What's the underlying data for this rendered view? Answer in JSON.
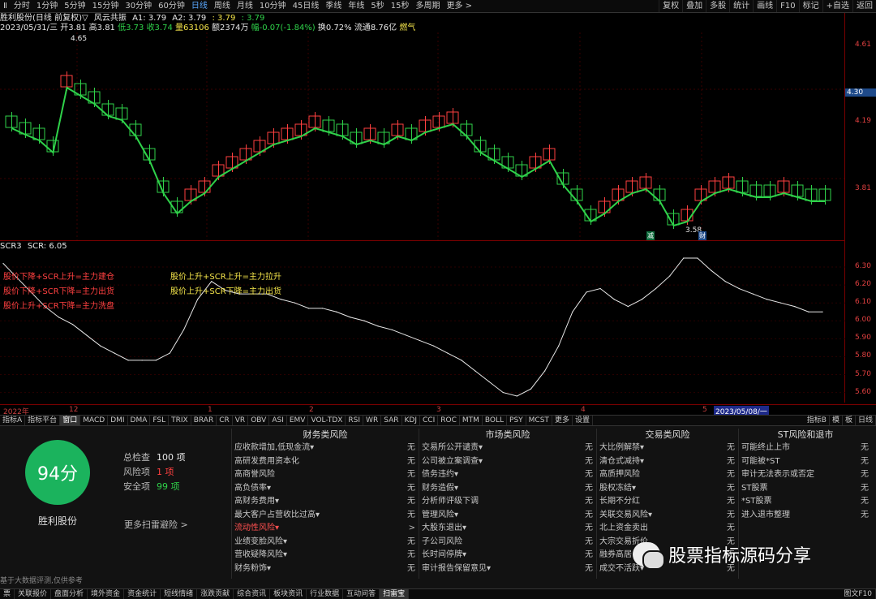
{
  "toolbar": {
    "left": [
      "分时",
      "1分钟",
      "5分钟",
      "15分钟",
      "30分钟",
      "60分钟",
      "日线",
      "周线",
      "月线",
      "10分钟",
      "45日线",
      "季线",
      "年线",
      "5秒",
      "15秒",
      "多周期",
      "更多 >"
    ],
    "active_index": 6,
    "right": [
      "复权",
      "叠加",
      "多股",
      "统计",
      "画线",
      "F10",
      "标记",
      "+自选",
      "返回"
    ]
  },
  "info": {
    "title": "胜利股份(日线 前复权)",
    "title_arrow": "▽",
    "indicator": "风云共振",
    "a1": "A1: 3.79",
    "a2": "A2: 3.79",
    "a2b": ": 3.79",
    "a2c": ": 3.79",
    "date": "2023/05/31/三",
    "open": "开3.81",
    "high": "高3.81",
    "low": "低3.73",
    "close": "收3.74",
    "volume": "量63106",
    "amount": "额2374万",
    "change": "幅-0.07(-1.84%)",
    "turnover": "换0.72%",
    "float": "流通8.76亿",
    "sector": "燃气"
  },
  "price_axis": {
    "labels": [
      "4.61",
      "4.30",
      "4.19",
      "3.81",
      "3.58"
    ],
    "current": "4.30",
    "high_mark": "4.65",
    "low_mark": "3.58"
  },
  "markers": [
    "减",
    "财"
  ],
  "scr": {
    "title": "SCR3",
    "value": "SCR: 6.05",
    "labels": [
      "6.30",
      "6.20",
      "6.10",
      "6.00",
      "5.90",
      "5.80",
      "5.70",
      "5.60"
    ]
  },
  "annotations": {
    "red": [
      "股价下降+SCR上升=主力建仓",
      "股价下降+SCR下降=主力出货",
      "股价上升+SCR下降=主力洗盘"
    ],
    "yellow": [
      "股价上升+SCR上升=主力拉升",
      "股价上升+SCR下降=主力出货"
    ]
  },
  "chart_data": {
    "type": "line",
    "series": [
      {
        "name": "SCR",
        "y": [
          6.32,
          6.24,
          6.16,
          6.08,
          6.02,
          5.98,
          5.92,
          5.86,
          5.82,
          5.78,
          5.78,
          5.78,
          5.82,
          5.95,
          6.12,
          6.22,
          6.17,
          6.15,
          6.15,
          6.15,
          6.12,
          6.1,
          6.07,
          6.07,
          6.05,
          6.02,
          6.0,
          5.97,
          5.95,
          5.92,
          5.89,
          5.86,
          5.82,
          5.78,
          5.72,
          5.66,
          5.6,
          5.58,
          5.62,
          5.72,
          5.86,
          6.05,
          6.16,
          6.18,
          6.12,
          6.08,
          6.12,
          6.18,
          6.25,
          6.35,
          6.35,
          6.28,
          6.22,
          6.18,
          6.15,
          6.12,
          6.1,
          6.08,
          6.05,
          6.05
        ]
      }
    ],
    "ylim": [
      5.58,
      6.35
    ]
  },
  "time_axis": [
    "2022年",
    "12",
    "1",
    "2",
    "3",
    "4",
    "5",
    "2023/05/08/一"
  ],
  "indicators": {
    "items": [
      "指标A",
      "指标平台",
      "窗口",
      "MACD",
      "DMI",
      "DMA",
      "FSL",
      "TRIX",
      "BRAR",
      "CR",
      "VR",
      "OBV",
      "ASI",
      "EMV",
      "VOL-TDX",
      "RSI",
      "WR",
      "SAR",
      "KDJ",
      "CCI",
      "ROC",
      "MTM",
      "BOLL",
      "PSY",
      "MCST",
      "更多",
      "设置"
    ],
    "right": [
      "指标B",
      "模",
      "板",
      "日线"
    ]
  },
  "scan": {
    "score": "94分",
    "stock": "胜利股份",
    "stats": [
      {
        "label": "总检查",
        "value": "100 项"
      },
      {
        "label": "风险项",
        "value": "1 项"
      },
      {
        "label": "安全项",
        "value": "99 项"
      }
    ],
    "more": "更多扫雷避险 >",
    "columns": [
      {
        "title": "财务类风险",
        "rows": [
          [
            "应收款增加,低现金流▾",
            "无"
          ],
          [
            "高研发费用资本化",
            "无"
          ],
          [
            "高商誉风险",
            "无"
          ],
          [
            "高负债率▾",
            "无"
          ],
          [
            "高财务费用▾",
            "无"
          ],
          [
            "最大客户占营收比过高▾",
            "无"
          ],
          [
            "流动性风险▾",
            ">"
          ],
          [
            "业绩变脸风险▾",
            "无"
          ],
          [
            "营收疑降风险▾",
            "无"
          ],
          [
            "财务粉饰▾",
            "无"
          ]
        ]
      },
      {
        "title": "市场类风险",
        "rows": [
          [
            "交易所公开谴责▾",
            "无"
          ],
          [
            "公司被立案调查▾",
            "无"
          ],
          [
            "债务违约▾",
            "无"
          ],
          [
            "财务造假▾",
            "无"
          ],
          [
            "分析师评级下调",
            "无"
          ],
          [
            "管理风险▾",
            "无"
          ],
          [
            "大股东退出▾",
            "无"
          ],
          [
            "子公司风险",
            "无"
          ],
          [
            "长时间停牌▾",
            "无"
          ],
          [
            "审计报告保留意见▾",
            "无"
          ]
        ]
      },
      {
        "title": "交易类风险",
        "rows": [
          [
            "大比例解禁▾",
            "无"
          ],
          [
            "清仓式减持▾",
            "无"
          ],
          [
            "高质押风险",
            "无"
          ],
          [
            "股权冻结▾",
            "无"
          ],
          [
            "长期不分红",
            "无"
          ],
          [
            "关联交易风险▾",
            "无"
          ],
          [
            "北上资金卖出",
            "无"
          ],
          [
            "大宗交易折价",
            "无"
          ],
          [
            "融券高居",
            "无"
          ],
          [
            "成交不活跃▾",
            "无"
          ]
        ]
      },
      {
        "title": "ST风险和退市",
        "rows": [
          [
            "可能终止上市",
            "无"
          ],
          [
            "可能被*ST",
            "无"
          ],
          [
            "审计无法表示或否定",
            "无"
          ],
          [
            "ST股票",
            "无"
          ],
          [
            "*ST股票",
            "无"
          ],
          [
            "进入退市整理",
            "无"
          ]
        ]
      }
    ],
    "disclaimer": "基于大数据评测,仅供参考"
  },
  "statusbar": {
    "items": [
      "票",
      "关联报价",
      "盘面分析",
      "境外资金",
      "资金统计",
      "短线情绪",
      "涨跌贡献",
      "综合资讯",
      "板块资讯",
      "行业数据",
      "互动问答",
      "扫雷宝"
    ],
    "active": "扫雷宝",
    "right": "图文F10"
  },
  "watermark": "股票指标源码分享",
  "colors": {
    "up": "#ff4040",
    "down": "#2fd24a",
    "yellow": "#f4e44a",
    "score": "#1bb35d"
  }
}
